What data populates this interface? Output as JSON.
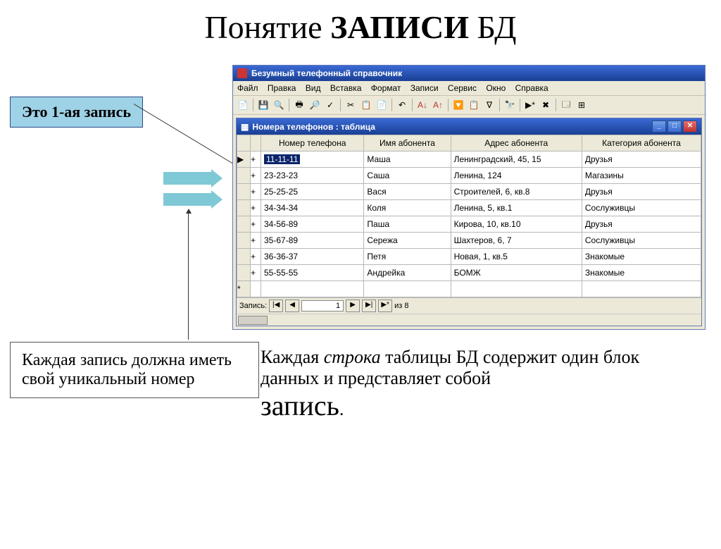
{
  "title": {
    "part1": "Понятие ",
    "bold": "ЗАПИСИ",
    "part2": " БД"
  },
  "callout1": "Это 1-ая запись",
  "callout2": "Каждая запись должна иметь свой уникальный номер",
  "body": {
    "l1a": "Каждая ",
    "l1_italic": "строка",
    "l1b": " таблицы БД содержит один блок данных и представляет собой ",
    "big": "запись",
    "period": "."
  },
  "app": {
    "title": "Безумный телефонный справочник",
    "menu": [
      "Файл",
      "Правка",
      "Вид",
      "Вставка",
      "Формат",
      "Записи",
      "Сервис",
      "Окно",
      "Справка"
    ],
    "inner_title": "Номера телефонов : таблица",
    "columns": [
      "Номер телефона",
      "Имя абонента",
      "Адрес абонента",
      "Категория абонента"
    ],
    "rows": [
      {
        "sel": "▶",
        "phone": "11-11-11",
        "name": "Маша",
        "addr": "Ленинградский, 45, 15",
        "cat": "Друзья",
        "selected": true
      },
      {
        "sel": "",
        "phone": "23-23-23",
        "name": "Саша",
        "addr": "Ленина, 124",
        "cat": "Магазины"
      },
      {
        "sel": "",
        "phone": "25-25-25",
        "name": "Вася",
        "addr": "Строителей, 6, кв.8",
        "cat": "Друзья"
      },
      {
        "sel": "",
        "phone": "34-34-34",
        "name": "Коля",
        "addr": "Ленина, 5, кв.1",
        "cat": "Сослуживцы"
      },
      {
        "sel": "",
        "phone": "34-56-89",
        "name": "Паша",
        "addr": "Кирова, 10, кв.10",
        "cat": "Друзья"
      },
      {
        "sel": "",
        "phone": "35-67-89",
        "name": "Сережа",
        "addr": "Шахтеров, 6, 7",
        "cat": "Сослуживцы"
      },
      {
        "sel": "",
        "phone": "36-36-37",
        "name": "Петя",
        "addr": "Новая, 1, кв.5",
        "cat": "Знакомые"
      },
      {
        "sel": "",
        "phone": "55-55-55",
        "name": "Андрейка",
        "addr": "БОМЖ",
        "cat": "Знакомые"
      }
    ],
    "nav": {
      "label": "Запись:",
      "current": "1",
      "of_label": "из",
      "total": "8"
    },
    "star_row": "*"
  }
}
